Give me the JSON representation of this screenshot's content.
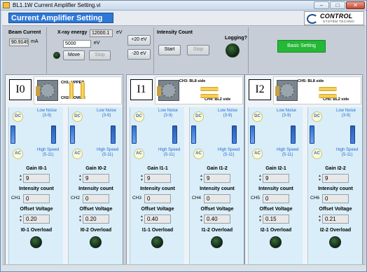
{
  "window": {
    "title": "BL1.1W Current Amplifier Setting.vi"
  },
  "app": {
    "title": "Current Amplifier Setting",
    "logo_name": "CONTROL",
    "logo_sub": "SYSTEM TECHNO"
  },
  "beam": {
    "label": "Beam Current",
    "value": "90.9149",
    "unit": "mA"
  },
  "xray": {
    "label": "X-ray energy",
    "current": "12000.1",
    "current_unit": "eV",
    "target": "5000",
    "target_unit": "eV",
    "move_label": "Move",
    "stop_label": "Stop",
    "plus_label": "+20 eV",
    "minus_label": "-20 eV"
  },
  "intensity": {
    "label": "Intensity Count",
    "start_label": "Start",
    "stop_label": "Stop",
    "logging_label": "Logging?"
  },
  "basic_setting": "Basic Setting",
  "common": {
    "dc": "DC",
    "ac": "AC",
    "low_noise": "Low Noise",
    "low_range": "(3-9)",
    "high_speed": "High Speed",
    "high_range": "(5-11)",
    "intensity_count": "Intensity count",
    "offset_voltage": "Offset Voltage"
  },
  "groups": [
    {
      "name": "I0",
      "cap_a": "CH1: UPPER",
      "cap_b": "CH2: LOWER",
      "channels": [
        {
          "gain_label": "Gain I0-1",
          "gain": "9",
          "ch": "CH1",
          "count": "0",
          "offset": "0.20",
          "overload": "I0-1 Overload"
        },
        {
          "gain_label": "Gain I0-2",
          "gain": "9",
          "ch": "CH2",
          "count": "0",
          "offset": "0.20",
          "overload": "I0-2 Overload"
        }
      ]
    },
    {
      "name": "I1",
      "cap_a": "CH3: BL8 side",
      "cap_b": "CH4: BL2 side",
      "channels": [
        {
          "gain_label": "Gain I1-1",
          "gain": "9",
          "ch": "CH3",
          "count": "0",
          "offset": "0.40",
          "overload": "I1-1 Overload"
        },
        {
          "gain_label": "Gain I1-2",
          "gain": "9",
          "ch": "CH4",
          "count": "0",
          "offset": "0.40",
          "overload": "I1-2 Overload"
        }
      ]
    },
    {
      "name": "I2",
      "cap_a": "CH5: BL8 side",
      "cap_b": "CH6: BL2 side",
      "channels": [
        {
          "gain_label": "Gain I2-1",
          "gain": "9",
          "ch": "CH5",
          "count": "0",
          "offset": "0.15",
          "overload": "I2-1 Overload"
        },
        {
          "gain_label": "Gain I2-2",
          "gain": "9",
          "ch": "CH6",
          "count": "0",
          "offset": "0.21",
          "overload": "I2-2 Overload"
        }
      ]
    }
  ]
}
